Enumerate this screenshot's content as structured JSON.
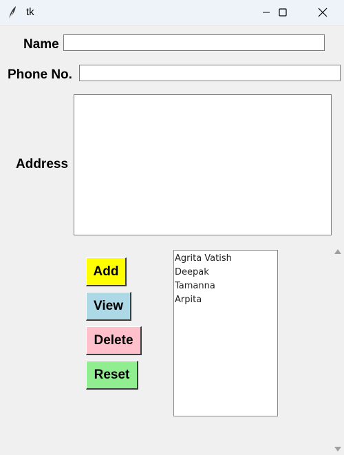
{
  "window": {
    "title": "tk"
  },
  "form": {
    "name_label": "Name",
    "name_value": "",
    "phone_label": "Phone No.",
    "phone_value": "",
    "address_label": "Address",
    "address_value": ""
  },
  "buttons": {
    "add": {
      "label": "Add",
      "color": "#ffff00"
    },
    "view": {
      "label": "View",
      "color": "#add8e6"
    },
    "delete": {
      "label": "Delete",
      "color": "#ffc0cb"
    },
    "reset": {
      "label": "Reset",
      "color": "#90ee90"
    }
  },
  "contacts": [
    "Agrita Vatish",
    "Deepak",
    "Tamanna",
    "Arpita"
  ],
  "icons": {
    "app": "feather-icon",
    "minimize": "minimize-icon",
    "maximize": "maximize-icon",
    "close": "close-icon",
    "scroll_up": "scroll-up-arrow-icon",
    "scroll_down": "scroll-down-arrow-icon"
  }
}
